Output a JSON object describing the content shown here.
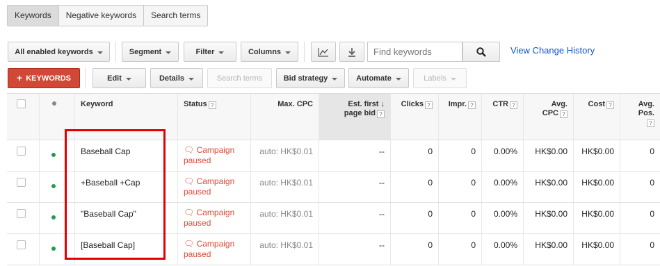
{
  "tabs": [
    {
      "label": "Keywords",
      "active": true
    },
    {
      "label": "Negative keywords",
      "active": false
    },
    {
      "label": "Search terms",
      "active": false
    }
  ],
  "toolbar1": {
    "all_enabled": "All enabled keywords",
    "segment": "Segment",
    "filter": "Filter",
    "columns": "Columns",
    "chart_icon": "line-chart-icon",
    "download_icon": "download-icon",
    "search_placeholder": "Find keywords",
    "search_icon": "magnifier-icon",
    "view_change_history": "View Change History"
  },
  "toolbar2": {
    "add_keywords": "KEYWORDS",
    "edit": "Edit",
    "details": "Details",
    "search_terms": "Search terms",
    "bid_strategy": "Bid strategy",
    "automate": "Automate",
    "labels": "Labels"
  },
  "columns": {
    "keyword": "Keyword",
    "status": "Status",
    "max_cpc": "Max. CPC",
    "first_page_bid_1": "Est. first",
    "first_page_bid_2": "page bid",
    "clicks": "Clicks",
    "impr": "Impr.",
    "ctr": "CTR",
    "avg_cpc_1": "Avg.",
    "avg_cpc_2": "CPC",
    "cost": "Cost",
    "avg_pos_1": "Avg.",
    "avg_pos_2": "Pos.",
    "help": "?",
    "sort_arrow": "↓"
  },
  "rows": [
    {
      "keyword": "Baseball Cap",
      "status_1": "Campaign",
      "status_2": "paused",
      "max_cpc": "auto: HK$0.01",
      "first_page_bid": "--",
      "clicks": "0",
      "impr": "0",
      "ctr": "0.00%",
      "avg_cpc": "HK$0.00",
      "cost": "HK$0.00",
      "avg_pos": "0"
    },
    {
      "keyword": "+Baseball +Cap",
      "status_1": "Campaign",
      "status_2": "paused",
      "max_cpc": "auto: HK$0.01",
      "first_page_bid": "--",
      "clicks": "0",
      "impr": "0",
      "ctr": "0.00%",
      "avg_cpc": "HK$0.00",
      "cost": "HK$0.00",
      "avg_pos": "0"
    },
    {
      "keyword": "\"Baseball Cap\"",
      "status_1": "Campaign",
      "status_2": "paused",
      "max_cpc": "auto: HK$0.01",
      "first_page_bid": "--",
      "clicks": "0",
      "impr": "0",
      "ctr": "0.00%",
      "avg_cpc": "HK$0.00",
      "cost": "HK$0.00",
      "avg_pos": "0"
    },
    {
      "keyword": "[Baseball Cap]",
      "status_1": "Campaign",
      "status_2": "paused",
      "max_cpc": "auto: HK$0.01",
      "first_page_bid": "--",
      "clicks": "0",
      "impr": "0",
      "ctr": "0.00%",
      "avg_cpc": "HK$0.00",
      "cost": "HK$0.00",
      "avg_pos": "0"
    }
  ],
  "colors": {
    "enabled_dot": "#1e9e4a",
    "header_dot": "#888888",
    "status_paused": "#dd4b39",
    "add_button": "#d14836",
    "link": "#1155cc",
    "highlight_box": "#e00000"
  }
}
